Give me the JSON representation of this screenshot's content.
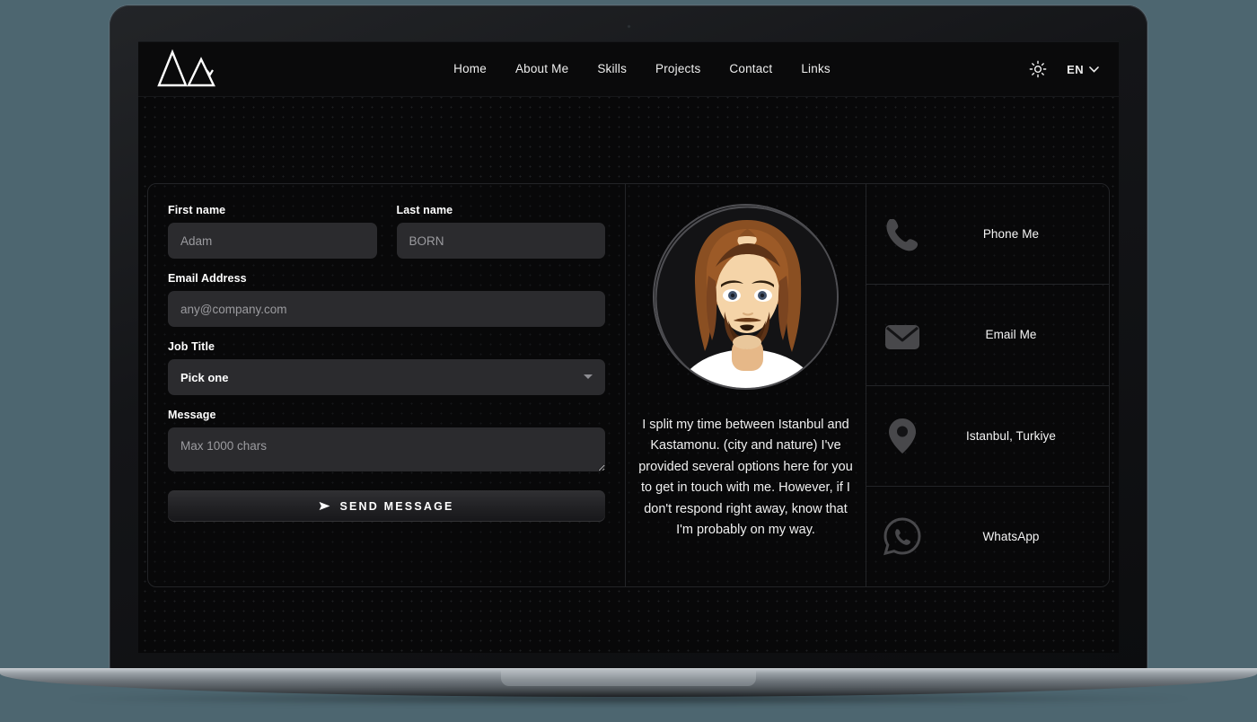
{
  "header": {
    "logo_name": "mountains-logo",
    "nav": [
      {
        "label": "Home"
      },
      {
        "label": "About Me"
      },
      {
        "label": "Skills"
      },
      {
        "label": "Projects"
      },
      {
        "label": "Contact"
      },
      {
        "label": "Links"
      }
    ],
    "theme_toggle_icon": "sun-icon",
    "language": {
      "value": "EN",
      "chevron_icon": "chevron-down-icon"
    }
  },
  "form": {
    "first_name": {
      "label": "First name",
      "placeholder": "Adam",
      "value": ""
    },
    "last_name": {
      "label": "Last name",
      "placeholder": "BORN",
      "value": ""
    },
    "email": {
      "label": "Email Address",
      "placeholder": "any@company.com",
      "value": ""
    },
    "job_title": {
      "label": "Job Title",
      "selected": "Pick one",
      "options": [
        "Pick one"
      ]
    },
    "message": {
      "label": "Message",
      "placeholder": "Max 1000 chars",
      "value": ""
    },
    "submit": {
      "label": "SEND MESSAGE",
      "icon": "send-icon"
    }
  },
  "profile": {
    "avatar_name": "avatar-illustration",
    "bio": "I split my time between Istanbul and Kastamonu. (city and nature) I've provided several options here for you to get in touch with me. However, if I don't respond right away, know that I'm probably on my way."
  },
  "contact_methods": [
    {
      "icon": "phone-icon",
      "label": "Phone Me"
    },
    {
      "icon": "envelope-icon",
      "label": "Email Me"
    },
    {
      "icon": "map-pin-icon",
      "label": "Istanbul, Turkiye"
    },
    {
      "icon": "whatsapp-icon",
      "label": "WhatsApp"
    }
  ],
  "colors": {
    "page_background": "#080809",
    "desk_background": "#4d6670",
    "input_background": "#2b2b2e",
    "text_primary": "#f2f2f2",
    "placeholder": "#9b9b9f",
    "icon_grey": "#48484b",
    "border": "#232427"
  }
}
